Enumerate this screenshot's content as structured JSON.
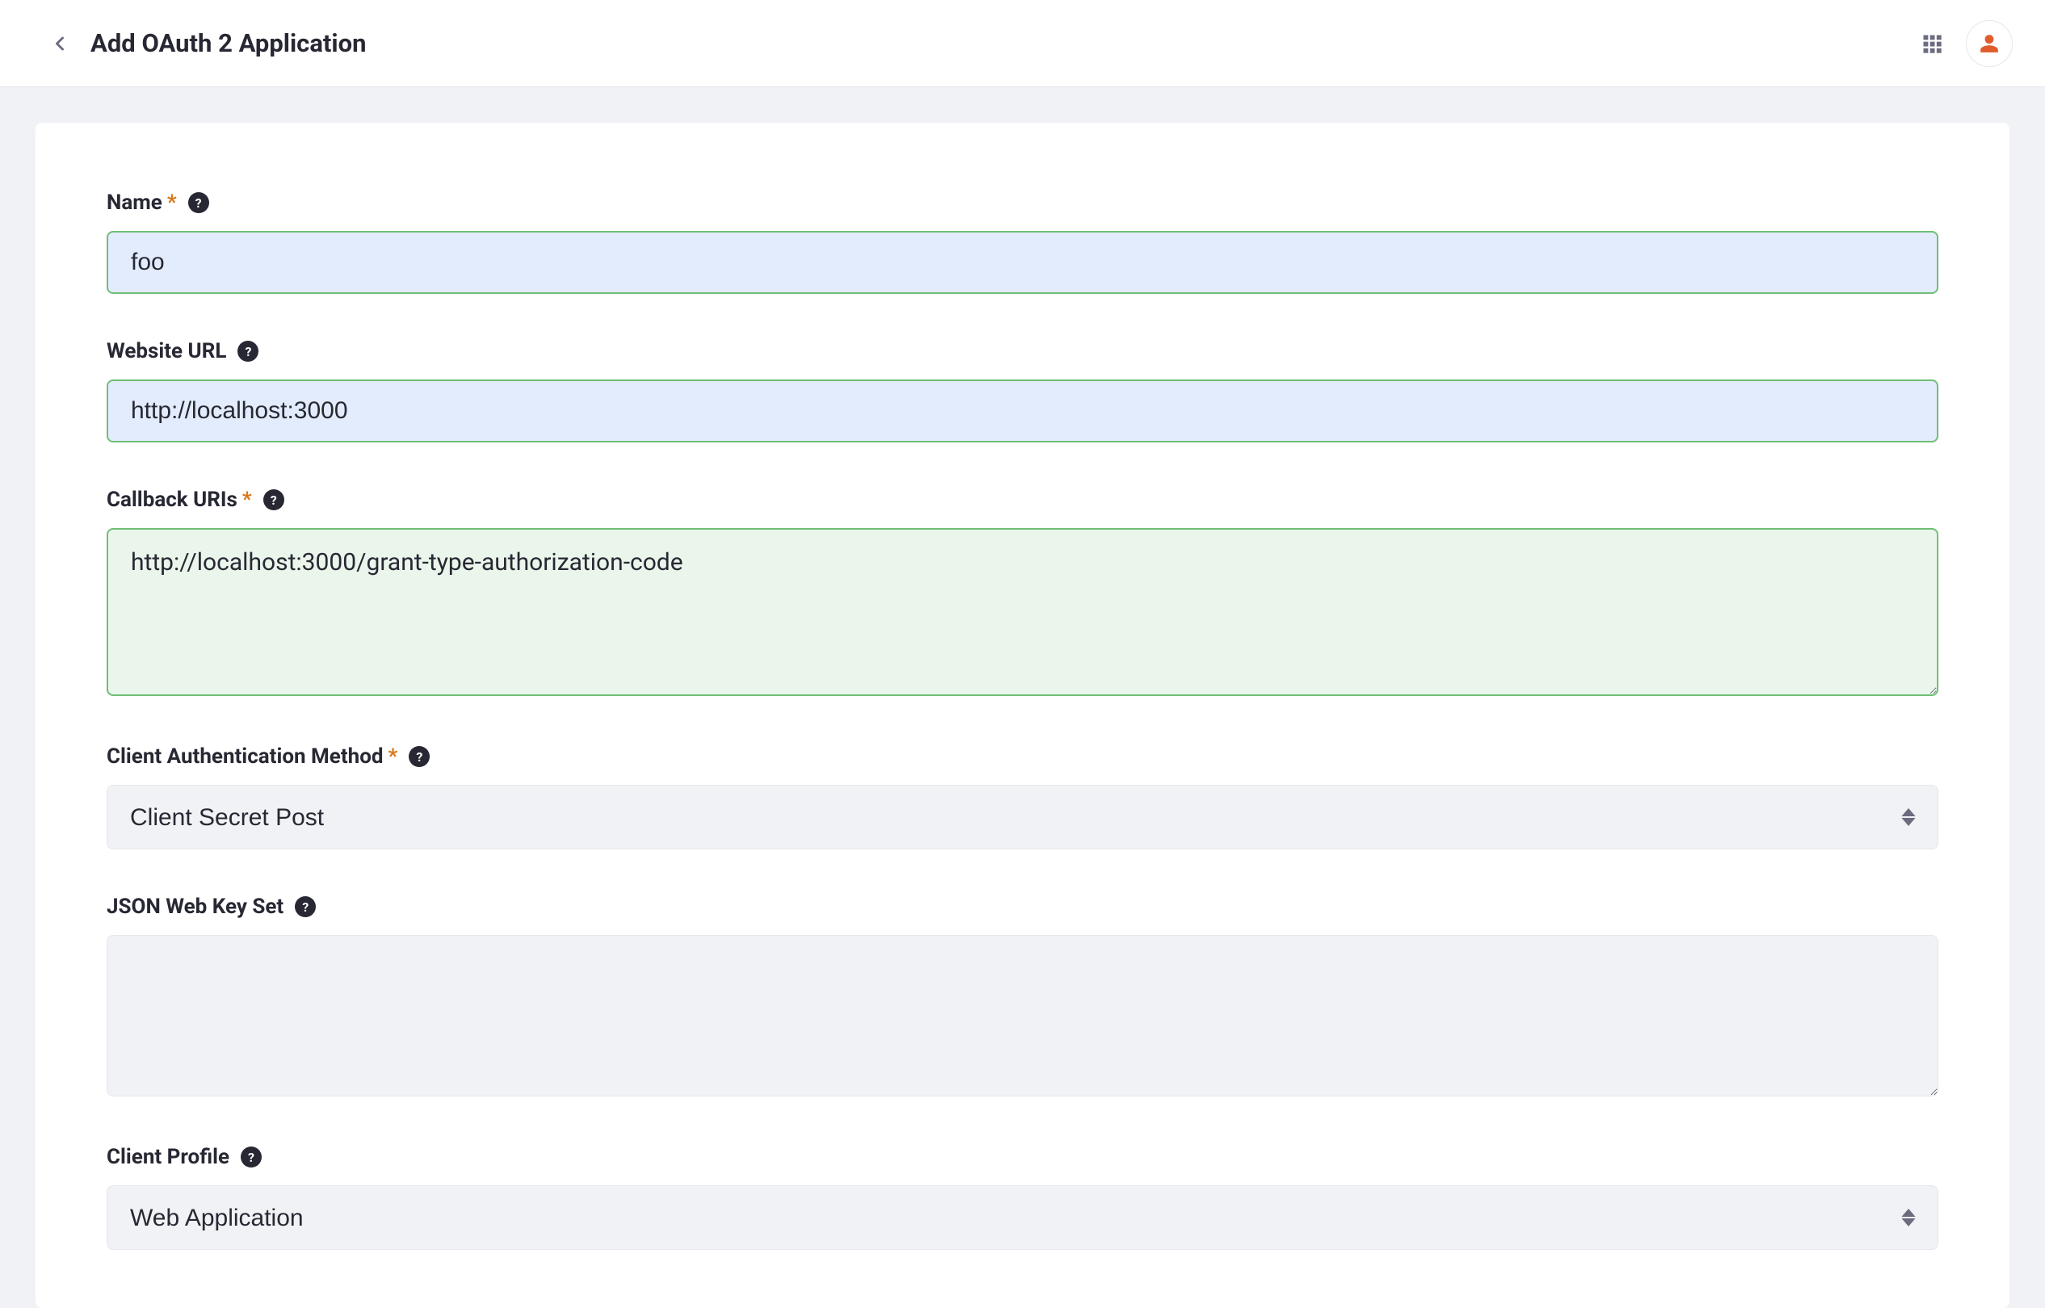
{
  "header": {
    "title": "Add OAuth 2 Application"
  },
  "form": {
    "name": {
      "label": "Name",
      "required": true,
      "value": "foo"
    },
    "websiteUrl": {
      "label": "Website URL",
      "required": false,
      "value": "http://localhost:3000"
    },
    "callbackUris": {
      "label": "Callback URIs",
      "required": true,
      "value": "http://localhost:3000/grant-type-authorization-code"
    },
    "clientAuthMethod": {
      "label": "Client Authentication Method",
      "required": true,
      "selected": "Client Secret Post"
    },
    "jwks": {
      "label": "JSON Web Key Set",
      "required": false,
      "value": ""
    },
    "clientProfile": {
      "label": "Client Profile",
      "required": false,
      "selected": "Web Application"
    }
  }
}
